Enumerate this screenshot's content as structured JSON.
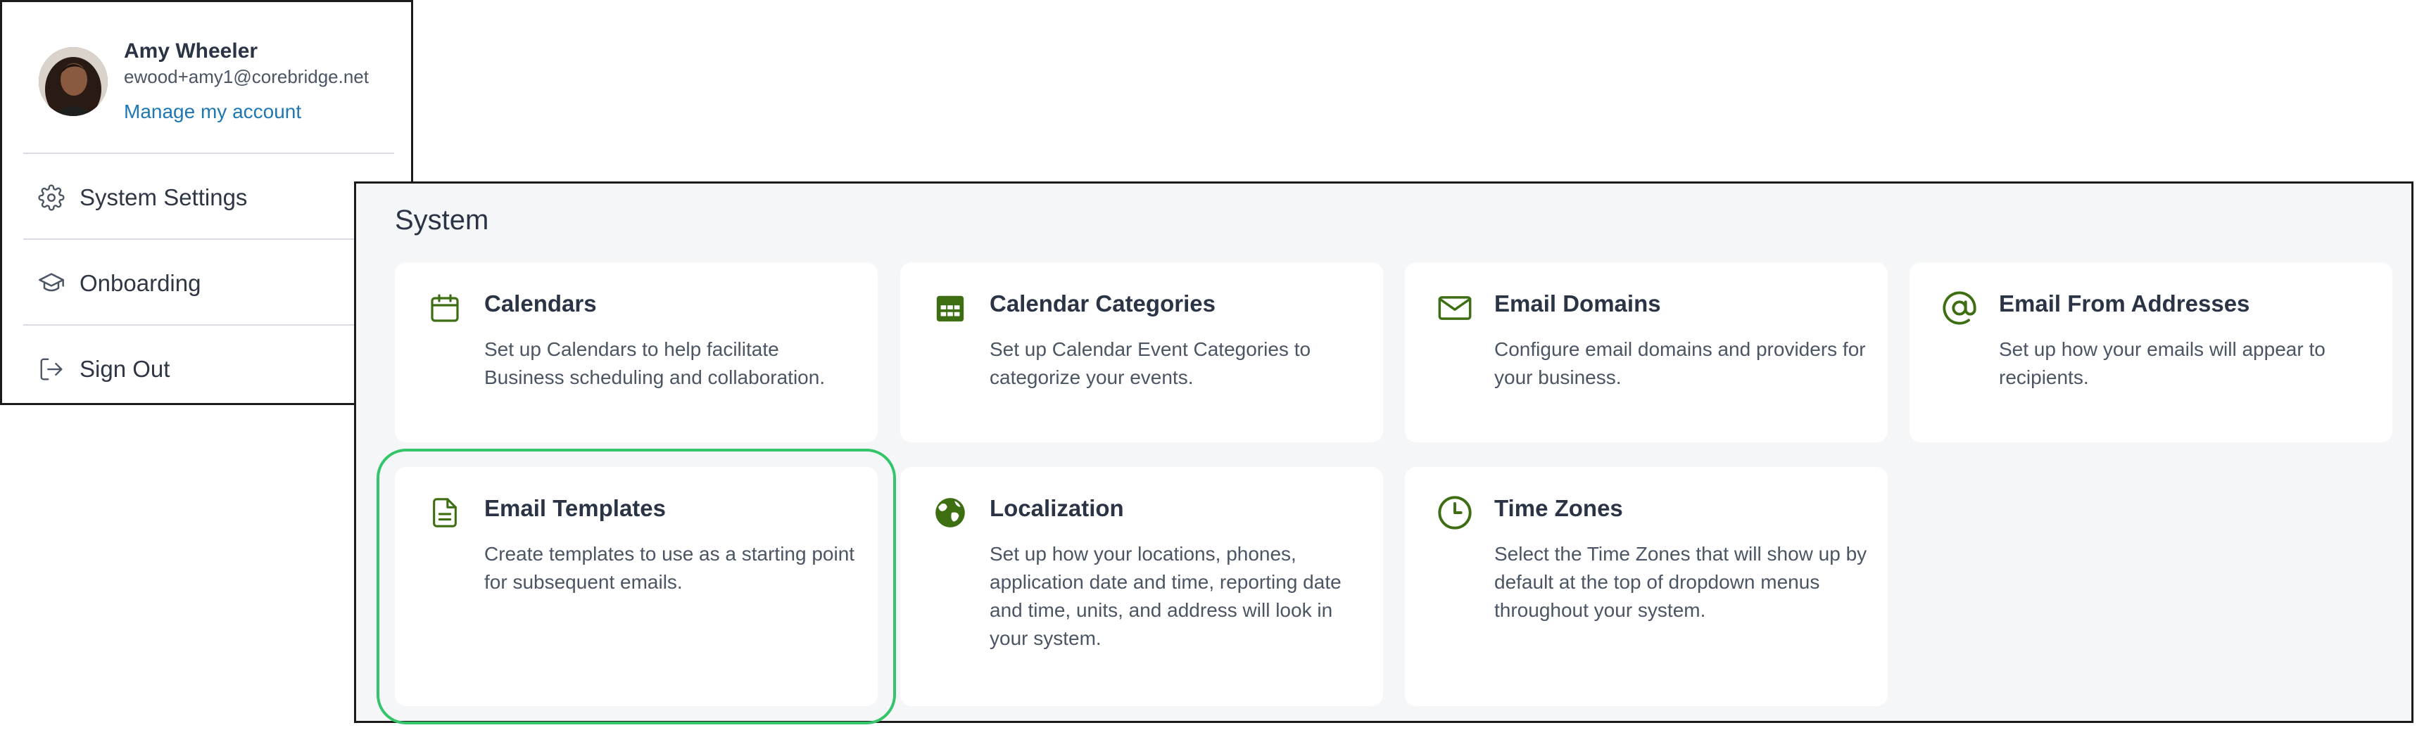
{
  "account": {
    "name": "Amy Wheeler",
    "email": "ewood+amy1@corebridge.net",
    "manage_link": "Manage my account",
    "menu_items": [
      {
        "label": "System Settings",
        "icon": "gear-icon"
      },
      {
        "label": "Onboarding",
        "icon": "graduation-cap-icon"
      },
      {
        "label": "Sign Out",
        "icon": "sign-out-icon"
      }
    ]
  },
  "system": {
    "title": "System",
    "cards": [
      {
        "title": "Calendars",
        "description": "Set up Calendars to help facilitate Business scheduling and collaboration.",
        "icon": "calendar-icon"
      },
      {
        "title": "Calendar Categories",
        "description": "Set up Calendar Event Categories to categorize your events.",
        "icon": "calendar-grid-icon"
      },
      {
        "title": "Email Domains",
        "description": "Configure email domains and providers for your business.",
        "icon": "envelope-icon"
      },
      {
        "title": "Email From Addresses",
        "description": "Set up how your emails will appear to recipients.",
        "icon": "at-sign-icon"
      },
      {
        "title": "Email Templates",
        "description": "Create templates to use as a starting point for subsequent emails.",
        "icon": "document-icon",
        "selected": true
      },
      {
        "title": "Localization",
        "description": "Set up how your locations, phones, application date and time, reporting date and time, units, and address will look in your system.",
        "icon": "globe-icon"
      },
      {
        "title": "Time Zones",
        "description": "Select the Time Zones that will show up by default at the top of dropdown menus throughout your system.",
        "icon": "clock-icon"
      }
    ]
  },
  "colors": {
    "accent_green": "#3d6e12",
    "link_blue": "#1f78b4",
    "selected_outline": "#34c46a",
    "panel_background": "#f5f6f8"
  }
}
